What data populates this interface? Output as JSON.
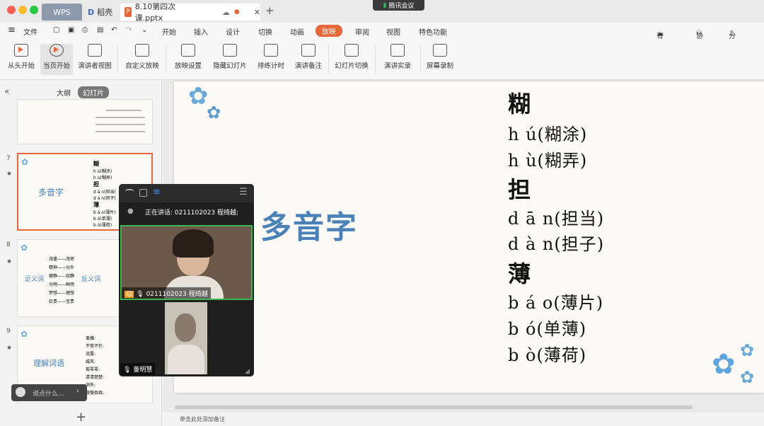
{
  "tabs": {
    "wps": "WPS",
    "daoke": "稻壳",
    "doc": "8.10第四次课.pptx",
    "meeting": "腾讯会议"
  },
  "menu": {
    "file": "文件",
    "start": "开始",
    "insert": "插入",
    "design": "设计",
    "switch": "切换",
    "animation": "动画",
    "show": "放映",
    "review": "审阅",
    "view": "视图",
    "special": "特色功能",
    "changes": "有修改",
    "collab": "协作",
    "share": "分享"
  },
  "ribbon": {
    "from_start": "从头开始",
    "from_current": "当页开始",
    "presenter": "演讲者视图",
    "custom": "自定义放映",
    "setup": "放映设置",
    "hide": "隐藏幻灯片",
    "rehearse": "排练计时",
    "notes": "演讲备注",
    "switch_slide": "幻灯片切换",
    "record": "演讲实录",
    "screen_rec": "屏幕录制"
  },
  "panel": {
    "outline": "大纲",
    "slides": "幻灯片"
  },
  "thumbs": [
    {
      "num": "7",
      "title": "多音字",
      "lines": [
        "糊",
        "h ú(糊涂)",
        "h ù(糊弄)",
        "担",
        "d ā n(担当)",
        "d à n(担子)",
        "薄",
        "b á o(薄片)",
        "b ó(单薄)",
        "b ò(薄荷)"
      ]
    },
    {
      "num": "8",
      "left": "近义词",
      "right": "反义词",
      "lines": [
        "茂盛——茂密",
        "精神——分外",
        "僻静——寂静",
        "分明——鲜明",
        "梦想——理想",
        "珍贵——宝贵"
      ]
    },
    {
      "num": "9",
      "title": "理解词语",
      "lines": [
        "蛮横:",
        "不慌不忙:",
        "流露:",
        "威风:",
        "孤零零:",
        "清清楚楚:",
        "消失:",
        "慢慢吞吞:"
      ]
    }
  ],
  "slide": {
    "title": "多音字",
    "chars": [
      {
        "hz": "糊",
        "py": [
          "h ú(糊涂)",
          "h ù(糊弄)"
        ]
      },
      {
        "hz": "担",
        "py": [
          "d ā n(担当)",
          "d à n(担子)"
        ]
      },
      {
        "hz": "薄",
        "py": [
          "b á o(薄片)",
          "b ó(单薄)",
          "b ò(薄荷)"
        ]
      }
    ]
  },
  "meeting": {
    "speaking": "正在讲话: 0211102023 程绮越;",
    "user1": "0211102023 程绮越",
    "user2": "董明慧"
  },
  "chat_placeholder": "说点什么...",
  "notes": "单击此处添加备注",
  "colors": {
    "accent": "#e8673a",
    "title_blue": "#4a82b8",
    "active_speaker": "#3cb454"
  }
}
